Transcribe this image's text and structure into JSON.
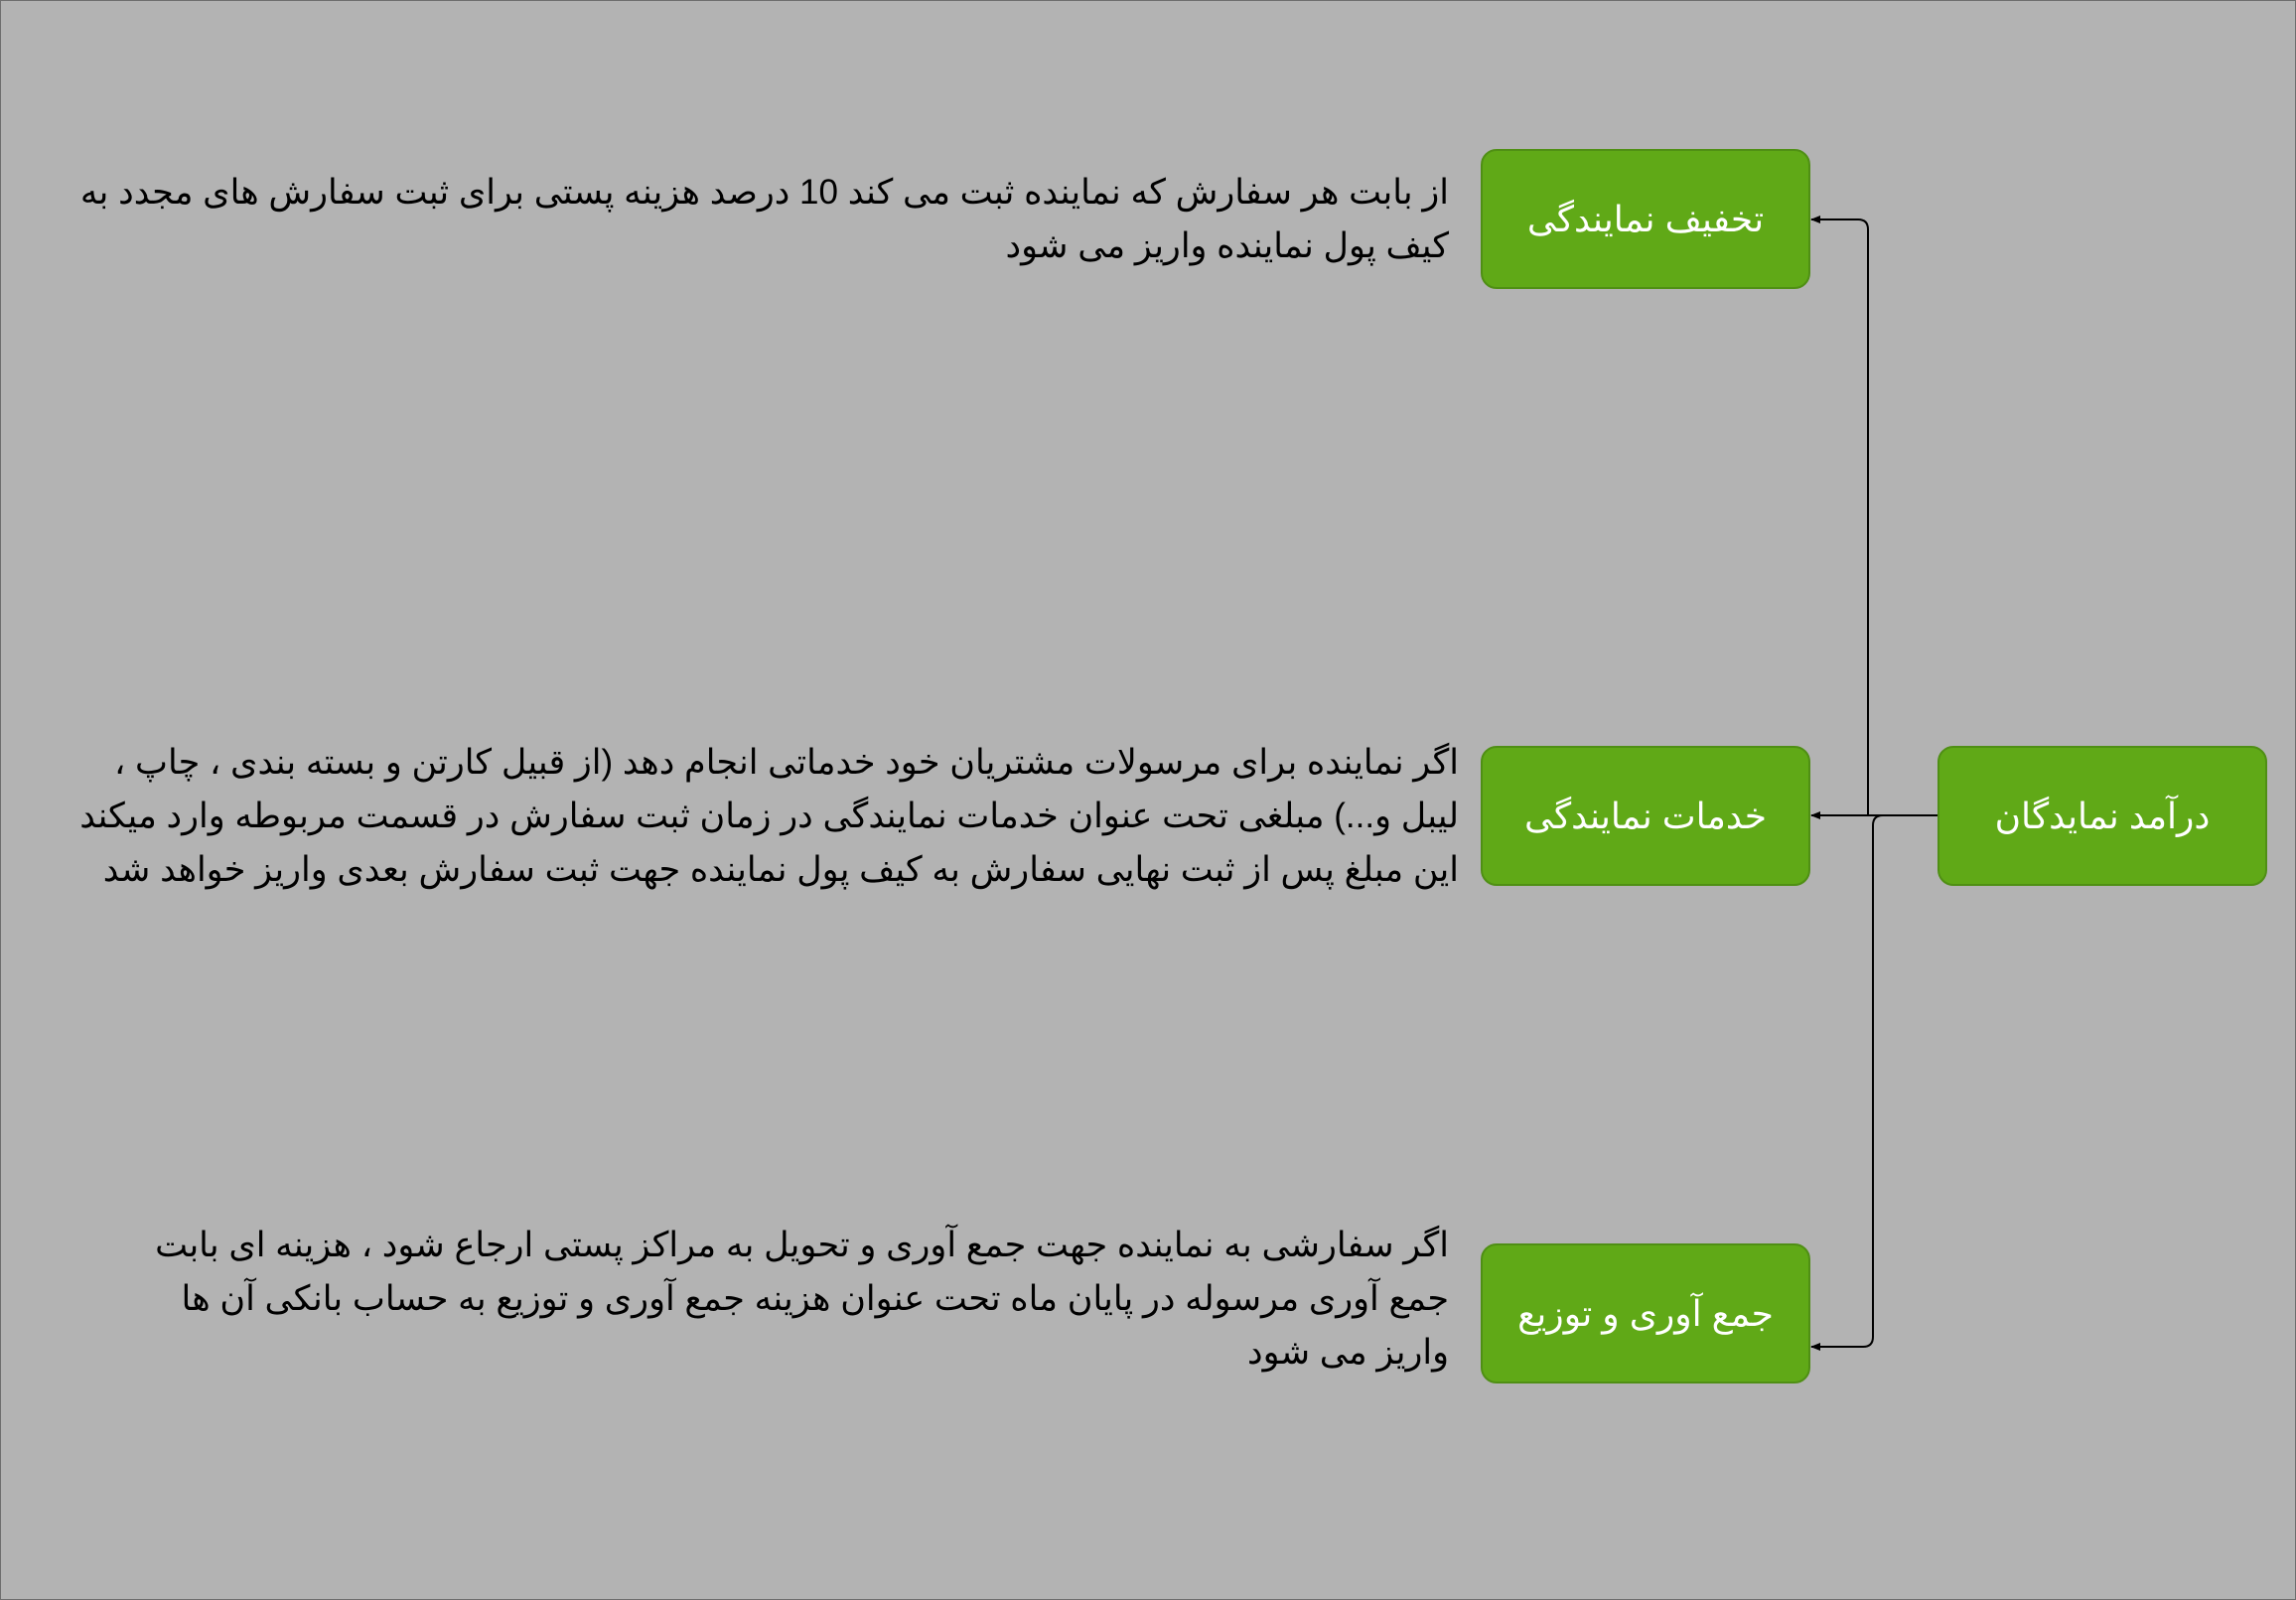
{
  "colors": {
    "background": "#b3b3b3",
    "node_fill": "#60a917",
    "node_border": "#4f8f14",
    "node_text": "#ffffff",
    "connector": "#000000",
    "description_text": "#000000"
  },
  "diagram": {
    "root": {
      "label": "درآمد نمایدگان"
    },
    "branches": [
      {
        "label": "تخفیف نمایندگی",
        "description_lines": [
          "از بابت هر سفارش که نماینده ثبت می کند 10 درصد هزینه پستی برای ثبت سفارش های مجدد به",
          "کیف پول نماینده واریز می شود"
        ]
      },
      {
        "label": "خدمات نمایندگی",
        "description_lines": [
          "اگر نماینده برای مرسولات مشتریان خود خدماتی انجام دهد (از قبیل کارتن و بسته بندی ، چاپ ،",
          "لیبل و...) مبلغی تحت عنوان خدمات نمایندگی در زمان ثبت سفارش در قسمت مربوطه وارد میکند",
          "این مبلغ پس از ثبت نهایی سفارش به کیف پول نماینده جهت ثبت سفارش بعدی واریز خواهد شد"
        ]
      },
      {
        "label": "جمع آوری و توزیع",
        "description_lines": [
          "اگر سفارشی به نماینده جهت جمع آوری و تحویل به مراکز پستی ارجاع شود ، هزینه ای بابت",
          "جمع آوری مرسوله در پایان ماه تحت عنوان هزینه جمع آوری و توزیع به حساب بانکی آن ها",
          "واریز می شود"
        ]
      }
    ]
  }
}
